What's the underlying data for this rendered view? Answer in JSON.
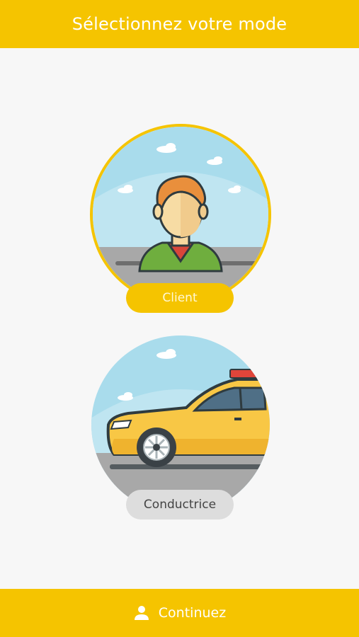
{
  "header": {
    "title": "Sélectionnez votre mode"
  },
  "modes": [
    {
      "id": "client",
      "label": "Client",
      "icon": "client-avatar-icon",
      "selected": true
    },
    {
      "id": "driver",
      "label": "Conductrice",
      "icon": "taxi-car-icon",
      "selected": false
    }
  ],
  "footer": {
    "button_label": "Continuez",
    "icon": "person-icon"
  },
  "colors": {
    "accent": "#f5c400",
    "sky": "#a8dcec",
    "road": "#a6a6a6",
    "label_inactive": "#dddddd"
  }
}
